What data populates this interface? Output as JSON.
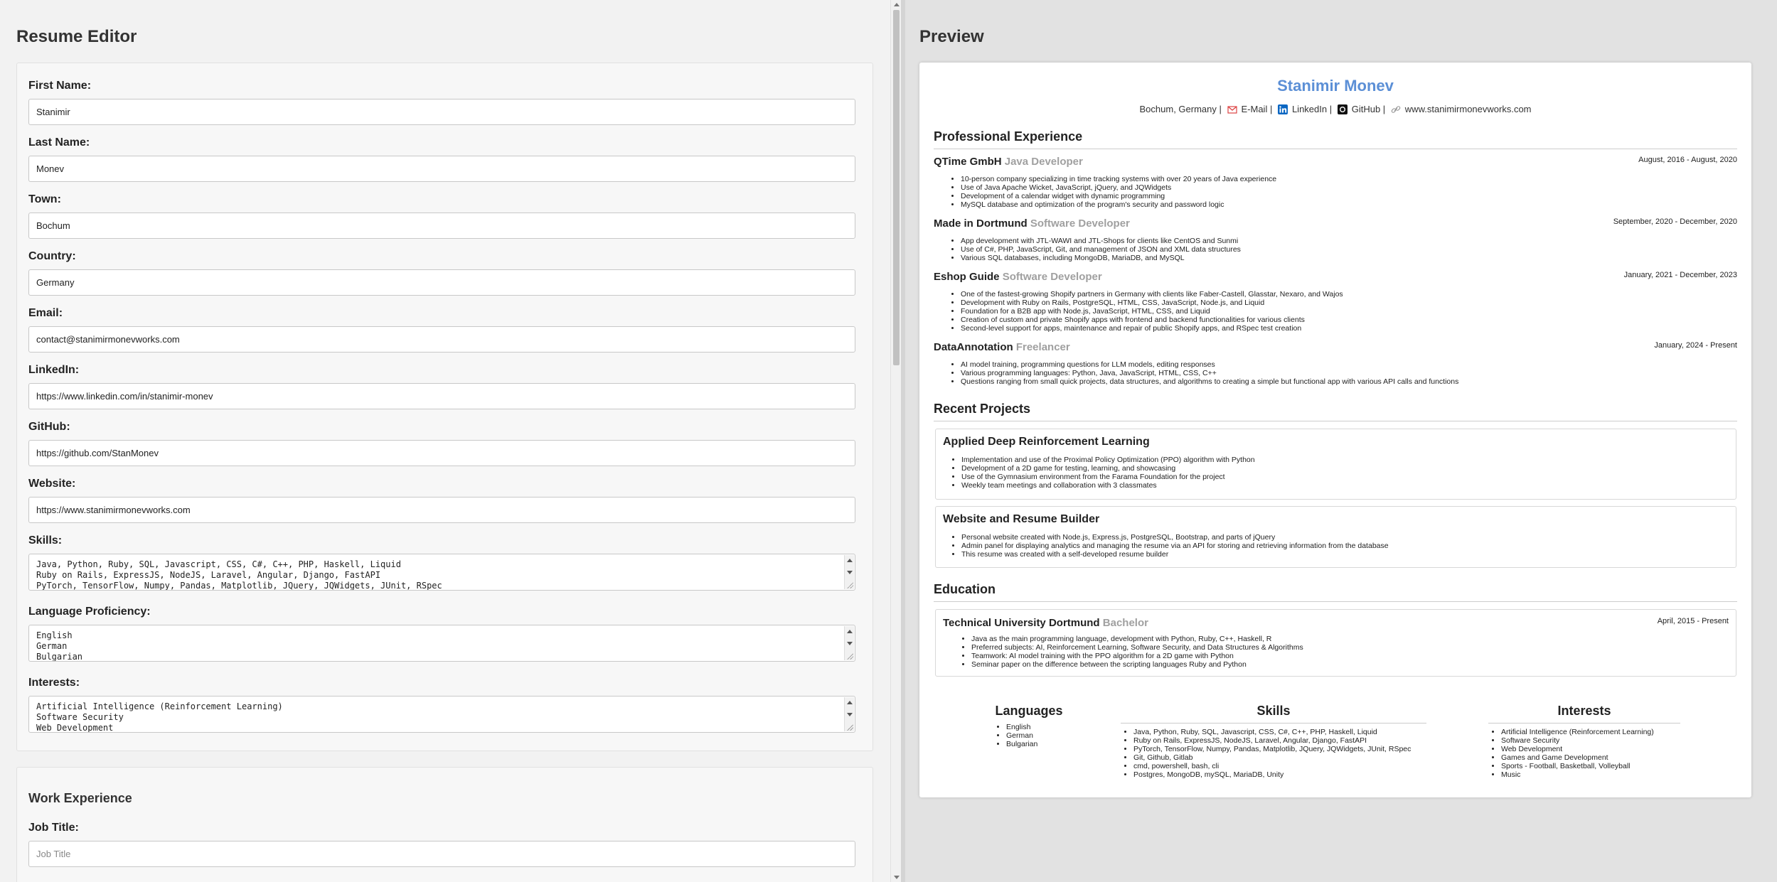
{
  "editor": {
    "title": "Resume Editor",
    "fields": {
      "first_name": {
        "label": "First Name:",
        "value": "Stanimir"
      },
      "last_name": {
        "label": "Last Name:",
        "value": "Monev"
      },
      "town": {
        "label": "Town:",
        "value": "Bochum"
      },
      "country": {
        "label": "Country:",
        "value": "Germany"
      },
      "email": {
        "label": "Email:",
        "value": "contact@stanimirmonevworks.com"
      },
      "linkedin": {
        "label": "LinkedIn:",
        "value": "https://www.linkedin.com/in/stanimir-monev"
      },
      "github": {
        "label": "GitHub:",
        "value": "https://github.com/StanMonev"
      },
      "website": {
        "label": "Website:",
        "value": "https://www.stanimirmonevworks.com"
      },
      "skills": {
        "label": "Skills:",
        "value": "Java, Python, Ruby, SQL, Javascript, CSS, C#, C++, PHP, Haskell, Liquid\nRuby on Rails, ExpressJS, NodeJS, Laravel, Angular, Django, FastAPI\nPyTorch, TensorFlow, Numpy, Pandas, Matplotlib, JQuery, JQWidgets, JUnit, RSpec"
      },
      "languages": {
        "label": "Language Proficiency:",
        "value": "English\nGerman\nBulgarian"
      },
      "interests": {
        "label": "Interests:",
        "value": "Artificial Intelligence (Reinforcement Learning)\nSoftware Security\nWeb Development"
      }
    },
    "work": {
      "heading": "Work Experience",
      "job_title_label": "Job Title:",
      "job_title_placeholder": "Job Title"
    }
  },
  "preview": {
    "title": "Preview",
    "name": "Stanimir Monev",
    "contact": {
      "location": "Bochum, Germany |",
      "email_label": "E-Mail |",
      "linkedin_label": "LinkedIn |",
      "github_label": "GitHub |",
      "website": "www.stanimirmonevworks.com"
    },
    "experience_heading": "Professional Experience",
    "jobs": [
      {
        "company": "QTime GmbH",
        "role": "Java Developer",
        "dates": "August, 2016 - August, 2020",
        "bullets": [
          "10-person company specializing in time tracking systems with over 20 years of Java experience",
          "Use of Java Apache Wicket, JavaScript, jQuery, and JQWidgets",
          "Development of a calendar widget with dynamic programming",
          "MySQL database and optimization of the program's security and password logic"
        ]
      },
      {
        "company": "Made in Dortmund",
        "role": "Software Developer",
        "dates": "September, 2020 - December, 2020",
        "bullets": [
          "App development with JTL-WAWI and JTL-Shops for clients like CentOS and Sunmi",
          "Use of C#, PHP, JavaScript, Git, and management of JSON and XML data structures",
          "Various SQL databases, including MongoDB, MariaDB, and MySQL"
        ]
      },
      {
        "company": "Eshop Guide",
        "role": "Software Developer",
        "dates": "January, 2021 - December, 2023",
        "bullets": [
          "One of the fastest-growing Shopify partners in Germany with clients like Faber-Castell, Glasstar, Nexaro, and Wajos",
          "Development with Ruby on Rails, PostgreSQL, HTML, CSS, JavaScript, Node.js, and Liquid",
          "Foundation for a B2B app with Node.js, JavaScript, HTML, CSS, and Liquid",
          "Creation of custom and private Shopify apps with frontend and backend functionalities for various clients",
          "Second-level support for apps, maintenance and repair of public Shopify apps, and RSpec test creation"
        ]
      },
      {
        "company": "DataAnnotation",
        "role": "Freelancer",
        "dates": "January, 2024 - Present",
        "bullets": [
          "AI model training, programming questions for LLM models, editing responses",
          "Various programming languages: Python, Java, JavaScript, HTML, CSS, C++",
          "Questions ranging from small quick projects, data structures, and algorithms to creating a simple but functional app with various API calls and functions"
        ]
      }
    ],
    "projects_heading": "Recent Projects",
    "projects": [
      {
        "title": "Applied Deep Reinforcement Learning",
        "bullets": [
          "Implementation and use of the Proximal Policy Optimization (PPO) algorithm with Python",
          "Development of a 2D game for testing, learning, and showcasing",
          "Use of the Gymnasium environment from the Farama Foundation for the project",
          "Weekly team meetings and collaboration with 3 classmates"
        ]
      },
      {
        "title": "Website and Resume Builder",
        "bullets": [
          "Personal website created with Node.js, Express.js, PostgreSQL, Bootstrap, and parts of jQuery",
          "Admin panel for displaying analytics and managing the resume via an API for storing and retrieving information from the database",
          "This resume was created with a self-developed resume builder"
        ]
      }
    ],
    "education_heading": "Education",
    "education": {
      "school": "Technical University Dortmund",
      "degree": "Bachelor",
      "dates": "April, 2015 - Present",
      "bullets": [
        "Java as the main programming language, development with Python, Ruby, C++, Haskell, R",
        "Preferred subjects: AI, Reinforcement Learning, Software Security, and Data Structures & Algorithms",
        "Teamwork: AI model training with the PPO algorithm for a 2D game with Python",
        "Seminar paper on the difference between the scripting languages Ruby and Python"
      ]
    },
    "languages": {
      "heading": "Languages",
      "items": [
        "English",
        "German",
        "Bulgarian"
      ]
    },
    "skills": {
      "heading": "Skills",
      "items": [
        "Java, Python, Ruby, SQL, Javascript, CSS, C#, C++, PHP, Haskell, Liquid",
        "Ruby on Rails, ExpressJS, NodeJS, Laravel, Angular, Django, FastAPI",
        "PyTorch, TensorFlow, Numpy, Pandas, Matplotlib, JQuery, JQWidgets, JUnit, RSpec",
        "Git, Github, Gitlab",
        "cmd, powershell, bash, cli",
        "Postgres, MongoDB, mySQL, MariaDB, Unity"
      ]
    },
    "interests": {
      "heading": "Interests",
      "items": [
        "Artificial Intelligence (Reinforcement Learning)",
        "Software Security",
        "Web Development",
        "Games and Game Development",
        "Sports - Football, Basketball, Volleyball",
        "Music"
      ]
    }
  },
  "icons": {
    "email": "gmail-icon",
    "linkedin": "linkedin-icon",
    "github": "github-icon",
    "website": "link-icon"
  },
  "colors": {
    "accent": "#5b8fd6",
    "role_gray": "#a0a0a0"
  }
}
